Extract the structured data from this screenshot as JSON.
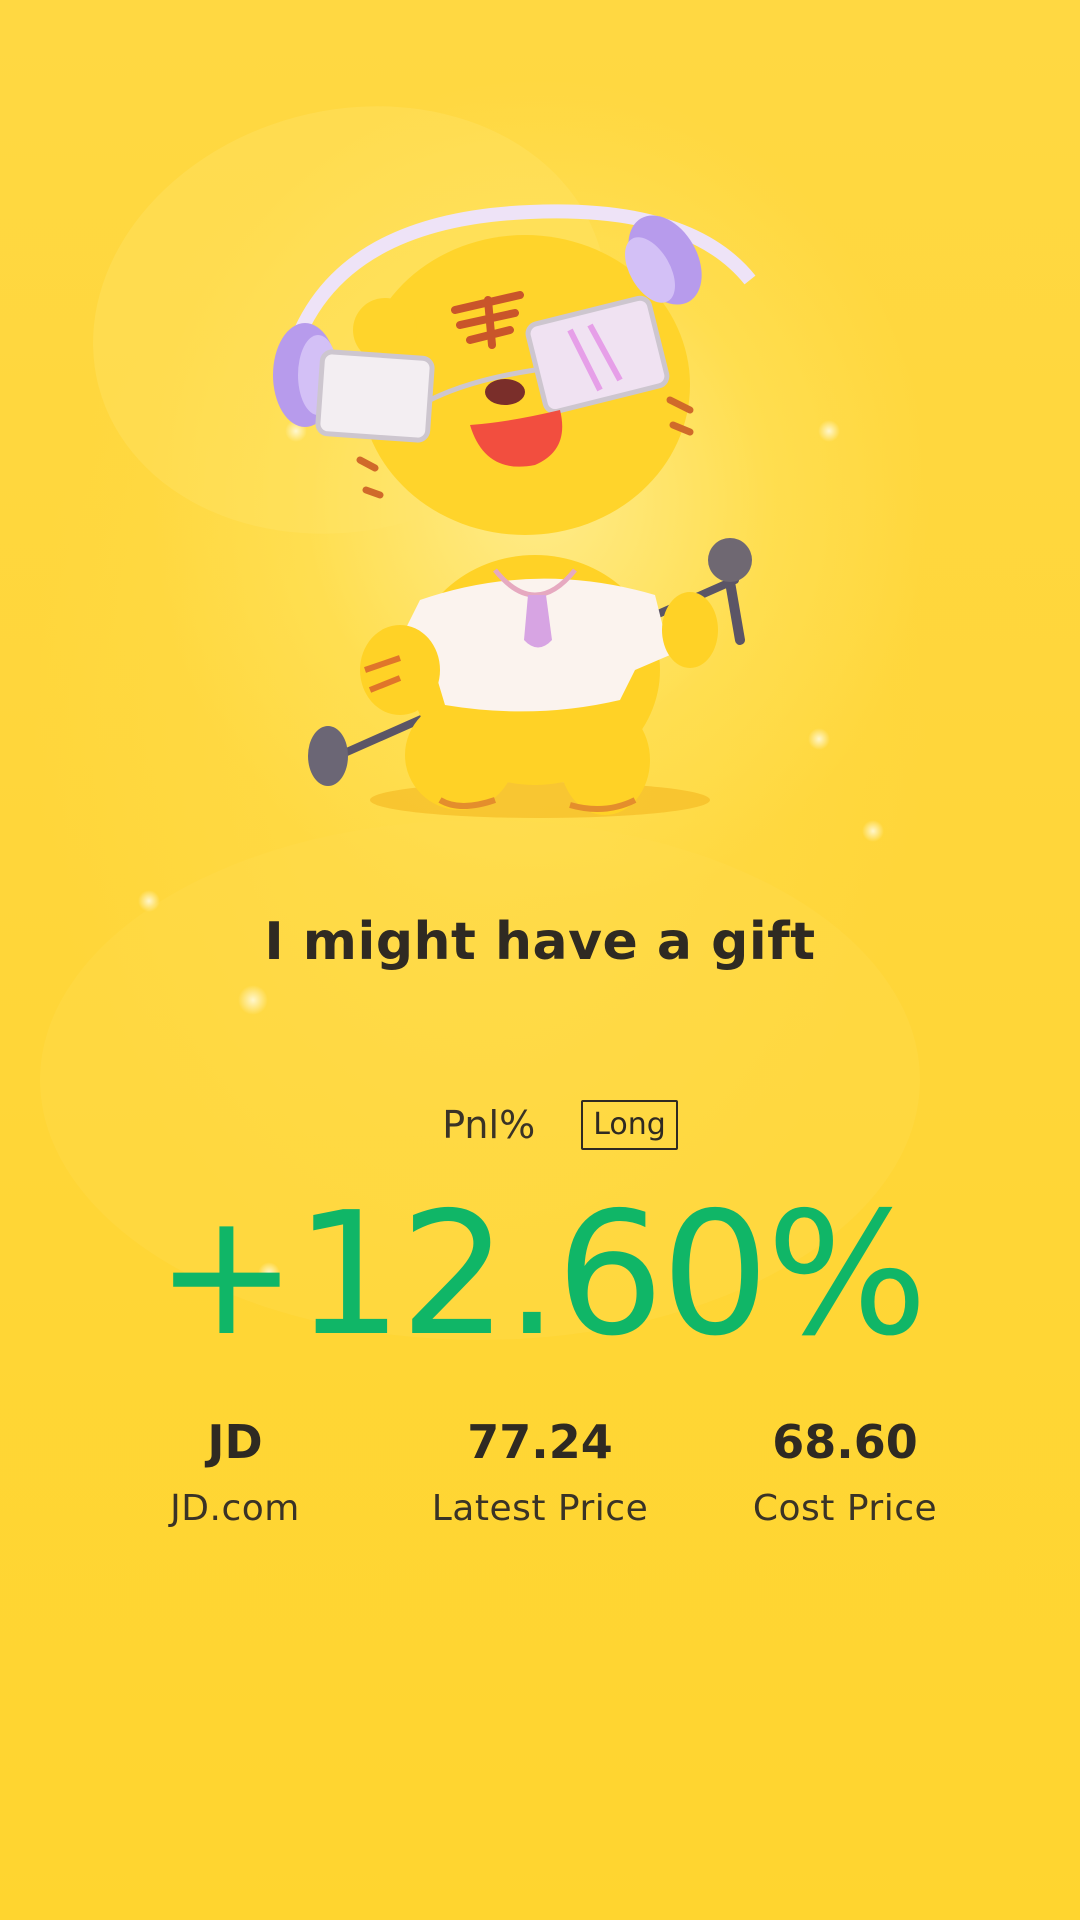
{
  "headline": "I might have a gift",
  "pnl": {
    "label": "Pnl%",
    "position_badge": "Long",
    "value": "+12.60%"
  },
  "stats": [
    {
      "value": "JD",
      "label": "JD.com"
    },
    {
      "value": "77.24",
      "label": "Latest Price"
    },
    {
      "value": "68.60",
      "label": "Cost Price"
    }
  ],
  "colors": {
    "background": "#FFD735",
    "gain": "#10B667",
    "text": "#2F2A22"
  },
  "illustration": "tiger-mascot-with-headphones-and-microphone"
}
